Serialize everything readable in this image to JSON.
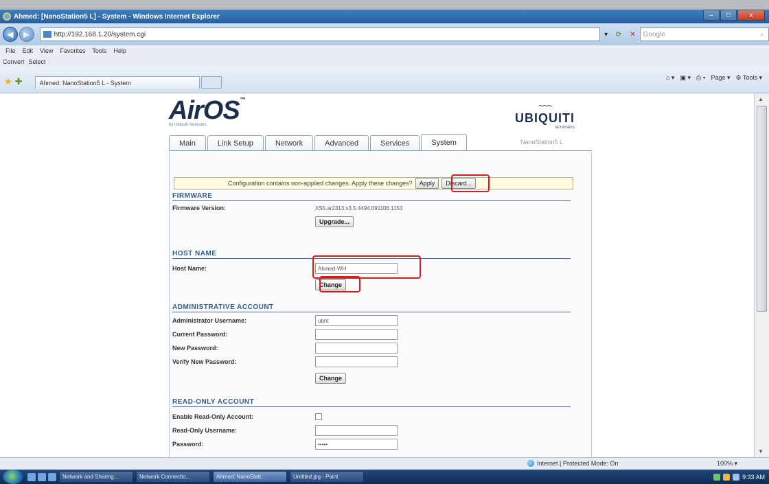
{
  "window": {
    "title": "Ahmed: [NanoStation5 L] - System - Windows Internet Explorer"
  },
  "window_buttons": {
    "minimize": "–",
    "maximize": "□",
    "close": "x"
  },
  "browser": {
    "url": "http://192.168.1.20/system.cgi",
    "search_placeholder": "Google",
    "menu": [
      "File",
      "Edit",
      "View",
      "Favorites",
      "Tools",
      "Help"
    ],
    "convert_label": "Convert",
    "select_label": "Select",
    "tab_title": "Ahmed: NanoStation5 L - System",
    "cmd": {
      "page": "Page",
      "tools": "Tools"
    },
    "status_zone": "Internet | Protected Mode: On",
    "zoom": "100%"
  },
  "airos": {
    "logo": "AirOS",
    "logo_sub": "by Ubiquiti Networks",
    "brand": "UBIQUITI",
    "brand_sub": "NETWORKS",
    "device_name": "NanoStation5 L",
    "tabs": [
      "Main",
      "Link Setup",
      "Network",
      "Advanced",
      "Services",
      "System"
    ],
    "active_tab": "System"
  },
  "notice": {
    "text": "Configuration contains non-applied changes. Apply these changes?",
    "apply": "Apply",
    "discard": "Discard..."
  },
  "firmware": {
    "heading": "FIRMWARE",
    "version_label": "Firmware Version:",
    "version_value": "XS5.ar2313.v3.5.4494.091106.1153",
    "upgrade": "Upgrade..."
  },
  "host": {
    "heading": "HOST NAME",
    "label": "Host Name:",
    "value": "Ahmed-WH",
    "change": "Change"
  },
  "admin": {
    "heading": "ADMINISTRATIVE ACCOUNT",
    "username_label": "Administrator Username:",
    "username_value": "ubnt",
    "current_pw_label": "Current Password:",
    "new_pw_label": "New Password:",
    "verify_pw_label": "Verify New Password:",
    "change": "Change"
  },
  "readonly": {
    "heading": "READ-ONLY ACCOUNT",
    "enable_label": "Enable Read-Only Account:",
    "username_label": "Read-Only Username:",
    "password_label": "Password:",
    "password_value": "•••••"
  },
  "taskbar": {
    "items": [
      "Network and Sharing...",
      "Network Connectio...",
      "Ahmed: NanoStati...",
      "Untitled.jpg - Paint"
    ],
    "active_index": 2,
    "clock": "9:33 AM"
  }
}
